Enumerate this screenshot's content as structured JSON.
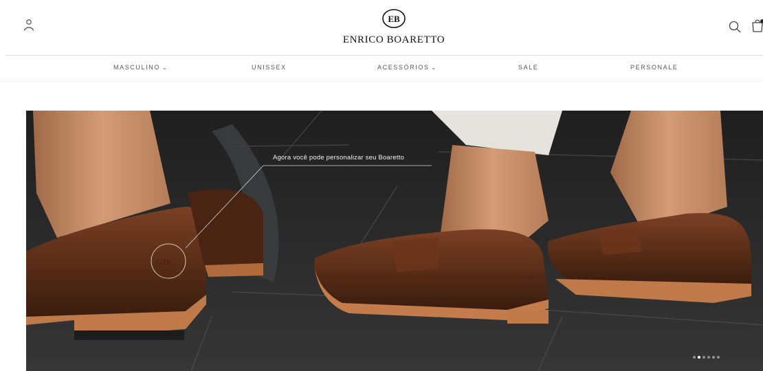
{
  "header": {
    "brand_name": "ENRICO BOARETTO",
    "logo_mark": "EB",
    "icons": {
      "account": "user-icon",
      "search": "search-icon",
      "cart": "shopping-bag-icon"
    }
  },
  "nav": {
    "items": [
      {
        "label": "MASCULINO",
        "has_dropdown": true
      },
      {
        "label": "UNISSEX",
        "has_dropdown": false
      },
      {
        "label": "ACESSÓRIOS",
        "has_dropdown": true
      },
      {
        "label": "SALE",
        "has_dropdown": false
      },
      {
        "label": "PERSONALE",
        "has_dropdown": false
      }
    ]
  },
  "hero": {
    "caption": "Agora você pode personalizar seu Boaretto",
    "engraving": "GTR",
    "slides_count": 6,
    "active_slide": 2
  },
  "colors": {
    "background": "#ffffff",
    "divider": "#d9d9d9",
    "nav_text": "#555555",
    "floor": "#2a2a2a",
    "leather": "#5a2e18",
    "sole": "#c07a4a",
    "skin": "#c9906a"
  }
}
